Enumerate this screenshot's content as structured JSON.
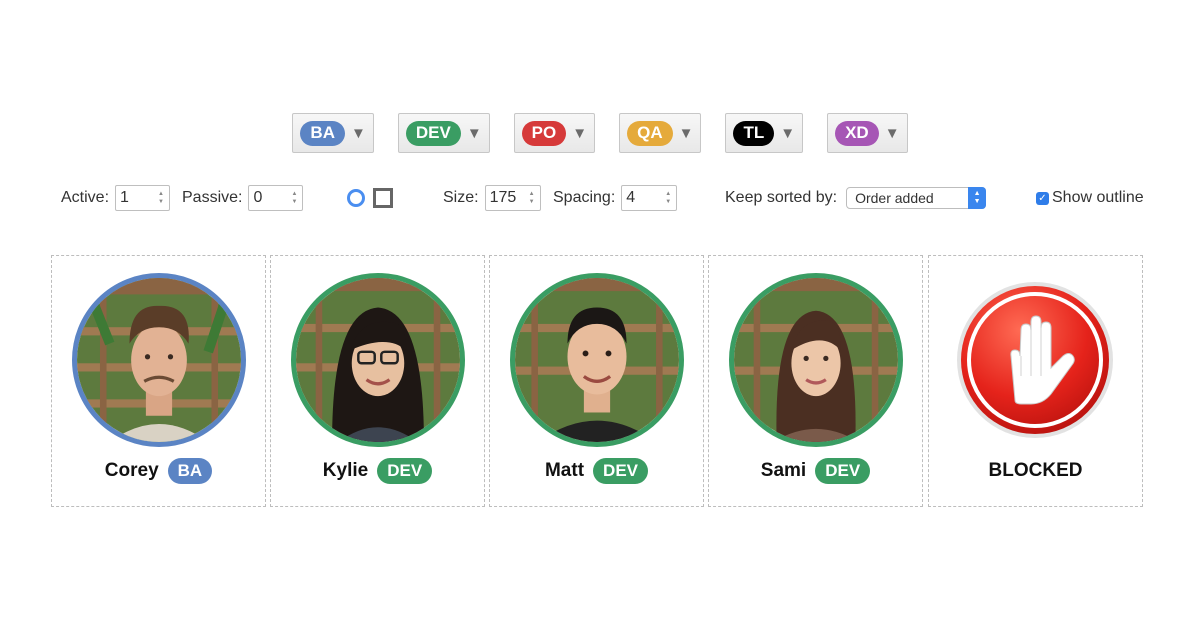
{
  "colors": {
    "BA": "#5b84c4",
    "DEV": "#3a9d63",
    "PO": "#d63a3a",
    "QA": "#e5aa3b",
    "TL": "#000000",
    "XD": "#a656b5"
  },
  "roles": [
    {
      "label": "BA",
      "caret": "▼"
    },
    {
      "label": "DEV",
      "caret": "▼"
    },
    {
      "label": "PO",
      "caret": "▼"
    },
    {
      "label": "QA",
      "caret": "▼"
    },
    {
      "label": "TL",
      "caret": "▼"
    },
    {
      "label": "XD",
      "caret": "▼"
    }
  ],
  "controls": {
    "active_label": "Active:",
    "active_value": "1",
    "passive_label": "Passive:",
    "passive_value": "0",
    "size_label": "Size:",
    "size_value": "175",
    "spacing_label": "Spacing:",
    "spacing_value": "4",
    "sort_label": "Keep sorted by:",
    "sort_value": "Order added",
    "outline_label": "Show outline",
    "outline_checked": true
  },
  "people": [
    {
      "name": "Corey",
      "role": "BA"
    },
    {
      "name": "Kylie",
      "role": "DEV"
    },
    {
      "name": "Matt",
      "role": "DEV"
    },
    {
      "name": "Sami",
      "role": "DEV"
    }
  ],
  "blocked": {
    "label": "BLOCKED",
    "icon": "stop-hand-icon"
  }
}
